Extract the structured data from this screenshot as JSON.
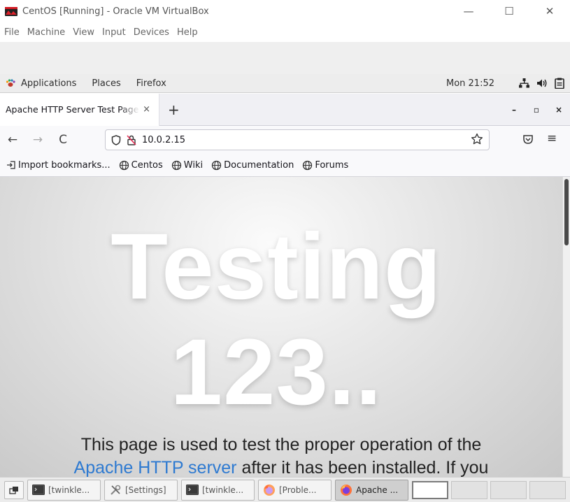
{
  "host_window": {
    "title": "CentOS [Running] - Oracle VM VirtualBox",
    "controls": {
      "minimize": "—",
      "maximize": "☐",
      "close": "✕"
    },
    "menu": [
      "File",
      "Machine",
      "View",
      "Input",
      "Devices",
      "Help"
    ]
  },
  "gnome_bar": {
    "items": [
      "Applications",
      "Places",
      "Firefox"
    ],
    "clock": "Mon 21:52",
    "status_icons": [
      "network-icon",
      "volume-icon",
      "clipboard-icon"
    ]
  },
  "firefox": {
    "tab": {
      "title": "Apache HTTP Server Test Page",
      "close": "×"
    },
    "new_tab": "+",
    "window_buttons": {
      "minimize": "–",
      "maximize": "▫",
      "close": "×"
    },
    "nav": {
      "back": "←",
      "forward": "→",
      "reload": "C"
    },
    "url": "10.0.2.15",
    "menu_glyph": "≡",
    "bookmarks": [
      "Import bookmarks...",
      "Centos",
      "Wiki",
      "Documentation",
      "Forums"
    ]
  },
  "page": {
    "hero_line1": "Testing",
    "hero_line2": "123..",
    "lead_line1": "This page is used to test the proper operation of the",
    "lead_link": "Apache HTTP server",
    "lead_rest": " after it has been installed. If you"
  },
  "taskbar": {
    "windows": [
      {
        "label": "[twinkle...",
        "icon": "terminal-icon",
        "active": false
      },
      {
        "label": "[Settings]",
        "icon": "settings-tools-icon",
        "active": false
      },
      {
        "label": "[twinkle...",
        "icon": "terminal-icon",
        "active": false
      },
      {
        "label": "[Proble...",
        "icon": "firefox-icon",
        "active": false
      },
      {
        "label": "Apache ...",
        "icon": "firefox-icon",
        "active": true
      }
    ],
    "workspaces": 4,
    "active_workspace": 1
  },
  "colors": {
    "link": "#2e7ad1",
    "firefox_orange": "#ff7139"
  }
}
